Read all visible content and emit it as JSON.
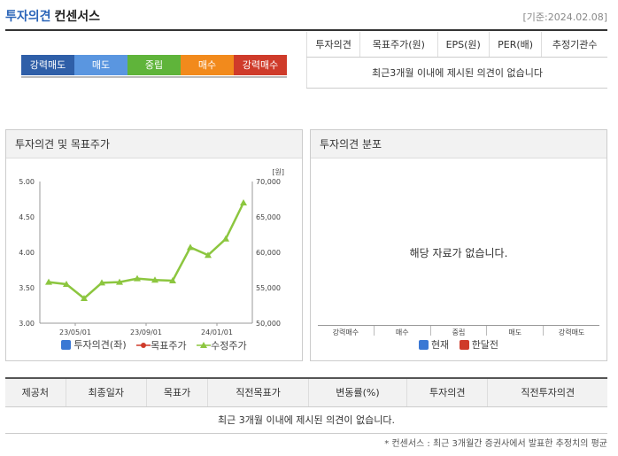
{
  "header": {
    "title_accent": "투자의견",
    "title_main": "컨센서스",
    "date": "[기준:2024.02.08]"
  },
  "scale": [
    "강력매도",
    "매도",
    "중립",
    "매수",
    "강력매수"
  ],
  "consensus_table": {
    "headers": [
      "투자의견",
      "목표주가(원)",
      "EPS(원)",
      "PER(배)",
      "추정기관수"
    ],
    "empty_message": "최근3개월 이내에 제시된 의견이 없습니다"
  },
  "opinion_chart_panel": {
    "title": "투자의견 및 목표주가",
    "unit": "[원]",
    "legend": [
      "투자의견(좌)",
      "목표주가",
      "수정주가"
    ],
    "legend_colors": [
      "#3a78d4",
      "#cf3b2a",
      "#7fbf2a"
    ]
  },
  "distribution_panel": {
    "title": "투자의견 분포",
    "nodata": "해당 자료가 없습니다.",
    "categories": [
      "강력매수",
      "매수",
      "중립",
      "매도",
      "강력매도"
    ],
    "legend": [
      "현재",
      "한달전"
    ],
    "legend_colors": [
      "#3a78d4",
      "#cf3b2a"
    ]
  },
  "bottom_table": {
    "headers": [
      "제공처",
      "최종일자",
      "목표가",
      "직전목표가",
      "변동률(%)",
      "투자의견",
      "직전투자의견"
    ],
    "empty_message": "최근 3개월 이내에 제시된 의견이 없습니다."
  },
  "footnote": "* 컨센서스 : 최근 3개월간 증권사에서 발표한 추정치의 평균",
  "chart_data": {
    "type": "line",
    "x_tick_labels": [
      "23/05/01",
      "23/09/01",
      "24/01/01"
    ],
    "x_ticks_at_index": [
      1.5,
      5.5,
      9.5
    ],
    "y_left": {
      "ticks": [
        "3.00",
        "3.50",
        "4.00",
        "4.50",
        "5.00"
      ],
      "range": [
        3.0,
        5.0
      ]
    },
    "y_right": {
      "ticks": [
        "50,000",
        "55,000",
        "60,000",
        "65,000",
        "70,000"
      ],
      "range": [
        50000,
        70000
      ],
      "unit": "[원]"
    },
    "series": [
      {
        "name": "수정주가",
        "axis": "right",
        "color": "#8cc63f",
        "values": [
          55800,
          55500,
          53500,
          55700,
          55800,
          56300,
          56100,
          56000,
          60700,
          59600,
          61900,
          67000
        ]
      }
    ]
  }
}
